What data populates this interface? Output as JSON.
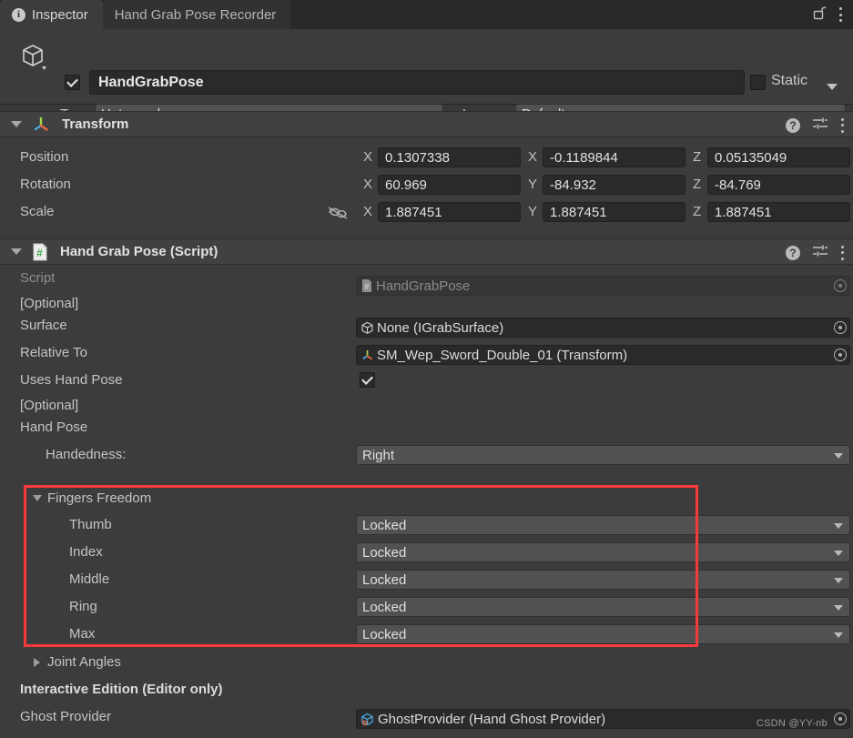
{
  "window": {
    "tabs": [
      {
        "label": "Inspector",
        "icon": "info-icon",
        "active": true
      },
      {
        "label": "Hand Grab Pose Recorder",
        "icon": "",
        "active": false
      }
    ],
    "lock_icon": "unlocked-padlock-icon",
    "menu_icon": "kebab-menu-icon"
  },
  "gameobject": {
    "enabled": true,
    "name": "HandGrabPose",
    "icon": "gameobject-cube-icon",
    "static_label": "Static",
    "static_checked": false,
    "tag_label": "Tag",
    "tag_value": "Untagged",
    "layer_label": "Layer",
    "layer_value": "Default"
  },
  "transform": {
    "title": "Transform",
    "icon": "transform-axis-icon",
    "expanded": true,
    "axes": [
      "X",
      "Y",
      "Z"
    ],
    "rows": [
      {
        "label": "Position",
        "values": [
          "0.1307338",
          "-0.1189844",
          "0.05135049"
        ],
        "has_link_icon": false
      },
      {
        "label": "Rotation",
        "values": [
          "60.969",
          "-84.932",
          "-84.769"
        ],
        "has_link_icon": false
      },
      {
        "label": "Scale",
        "values": [
          "1.887451",
          "1.887451",
          "1.887451"
        ],
        "has_link_icon": true,
        "link_icon": "unlinked-scale-icon"
      }
    ],
    "header_icons": [
      "help-icon",
      "preset-icon",
      "kebab-menu-icon"
    ]
  },
  "handgrabpose": {
    "title": "Hand Grab Pose (Script)",
    "icon": "cs-script-icon",
    "expanded": true,
    "header_icons": [
      "help-icon",
      "preset-icon",
      "kebab-menu-icon"
    ],
    "script_label": "Script",
    "script_value": "HandGrabPose",
    "script_icon": "cs-script-icon",
    "optional_label": "[Optional]",
    "surface_label": "Surface",
    "surface_value": "None (IGrabSurface)",
    "surface_icon": "mesh-cube-icon",
    "relative_to_label": "Relative To",
    "relative_to_value": "SM_Wep_Sword_Double_01 (Transform)",
    "relative_to_icon": "transform-axis-icon",
    "uses_hand_pose_label": "Uses Hand Pose",
    "uses_hand_pose_checked": true,
    "optional_label_2": "[Optional]",
    "hand_pose_label": "Hand Pose",
    "handedness_label": "Handedness:",
    "handedness_value": "Right",
    "fingers_freedom_label": "Fingers Freedom",
    "fingers_freedom_expanded": true,
    "fingers": [
      {
        "label": "Thumb",
        "value": "Locked"
      },
      {
        "label": "Index",
        "value": "Locked"
      },
      {
        "label": "Middle",
        "value": "Locked"
      },
      {
        "label": "Ring",
        "value": "Locked"
      },
      {
        "label": "Max",
        "value": "Locked"
      }
    ],
    "joint_angles_label": "Joint Angles",
    "joint_angles_expanded": false,
    "interactive_edition_label": "Interactive Edition (Editor only)",
    "ghost_provider_label": "Ghost Provider",
    "ghost_provider_value": "GhostProvider (Hand Ghost Provider)",
    "ghost_provider_icon": "prefab-cube-icon"
  },
  "annotation": {
    "highlight_color": "#fb3b3b"
  },
  "watermark": {
    "text": "CSDN @YY-nb"
  }
}
